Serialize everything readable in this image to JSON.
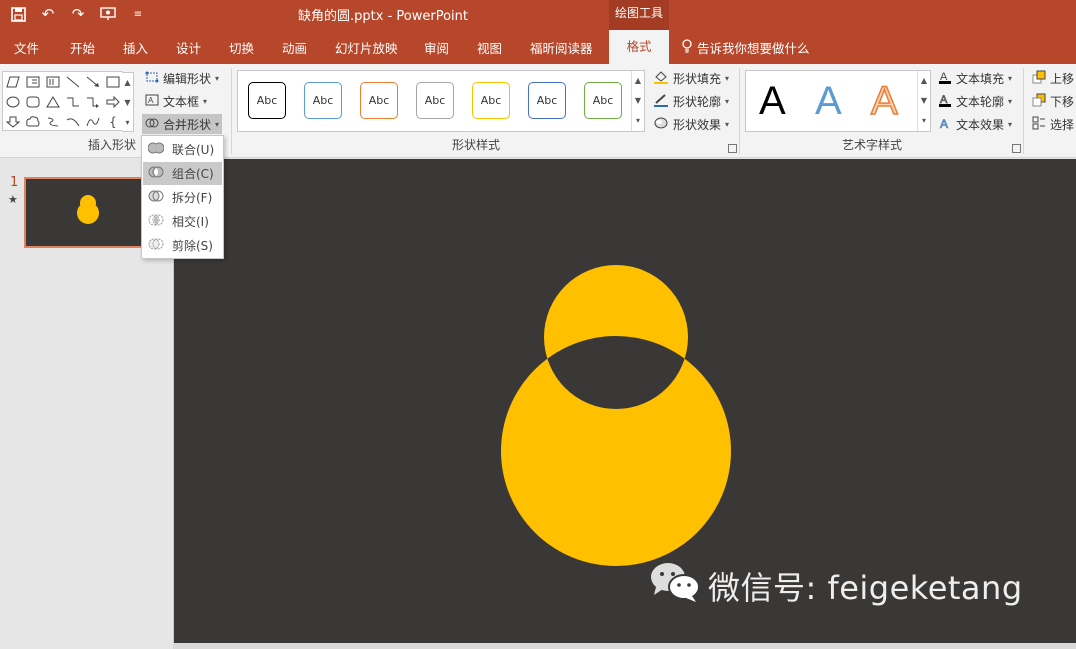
{
  "titlebar": {
    "title": "缺角的圆.pptx - PowerPoint",
    "context_tab_header": "绘图工具"
  },
  "tabs": [
    "文件",
    "开始",
    "插入",
    "设计",
    "切换",
    "动画",
    "幻灯片放映",
    "审阅",
    "视图",
    "福昕阅读器",
    "格式"
  ],
  "active_tab": "格式",
  "tell_me": "告诉我你想要做什么",
  "ribbon": {
    "insert_shapes": {
      "label": "插入形状",
      "edit_shape": "编辑形状",
      "text_box": "文本框",
      "merge_shapes": "合并形状"
    },
    "shape_styles": {
      "label": "形状样式",
      "sample_text": "Abc",
      "samples": [
        {
          "border": "#000000"
        },
        {
          "border": "#5b9bd5"
        },
        {
          "border": "#ed7d31"
        },
        {
          "border": "#a5a5a5"
        },
        {
          "border": "#ffc000"
        },
        {
          "border": "#4472c4"
        },
        {
          "border": "#70ad47"
        }
      ],
      "fill": "形状填充",
      "outline": "形状轮廓",
      "effects": "形状效果"
    },
    "wordart_styles": {
      "label": "艺术字样式",
      "sample_letter": "A",
      "text_fill": "文本填充",
      "text_outline": "文本轮廓",
      "text_effects": "文本效果"
    },
    "arrange": {
      "bring_forward": "上移",
      "send_backward": "下移",
      "selection_pane": "选择"
    }
  },
  "merge_menu": {
    "items": [
      {
        "label": "联合(U)",
        "name": "union"
      },
      {
        "label": "组合(C)",
        "name": "combine"
      },
      {
        "label": "拆分(F)",
        "name": "fragment"
      },
      {
        "label": "相交(I)",
        "name": "intersect"
      },
      {
        "label": "剪除(S)",
        "name": "subtract"
      }
    ],
    "highlighted": "组合(C)"
  },
  "slides_pane": {
    "slide_number": "1",
    "star": "★"
  },
  "canvas": {
    "background": "#3a3836",
    "shape_color": "#ffc000",
    "watermark": "微信号: feigeketang"
  },
  "colors": {
    "brand": "#b7472a",
    "ribbon_bg": "#f3f3f3"
  }
}
